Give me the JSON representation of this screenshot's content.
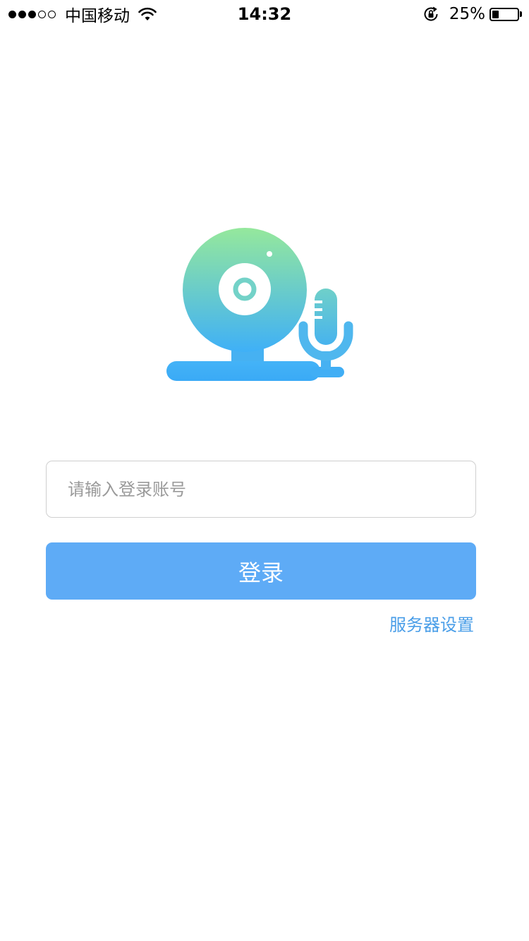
{
  "status_bar": {
    "carrier": "中国移动",
    "time": "14:32",
    "battery_percent": "25%",
    "battery_level": 0.25,
    "signal_bars_filled": 3,
    "signal_bars_total": 5,
    "icons": [
      "signal-dots-icon",
      "wifi-icon",
      "rotation-lock-icon",
      "battery-icon"
    ]
  },
  "logo": {
    "icon": "webcam-microphone-logo-icon",
    "gradient_top": "#95e89c",
    "gradient_bottom": "#3fb0f7"
  },
  "login_form": {
    "account_input": {
      "placeholder": "请输入登录账号",
      "value": ""
    },
    "login_label": "登录",
    "server_settings_label": "服务器设置"
  },
  "colors": {
    "primary_button": "#5eabf6",
    "link": "#4a9ee8",
    "input_border": "#cfcfcf",
    "placeholder": "#9a9a9a"
  }
}
